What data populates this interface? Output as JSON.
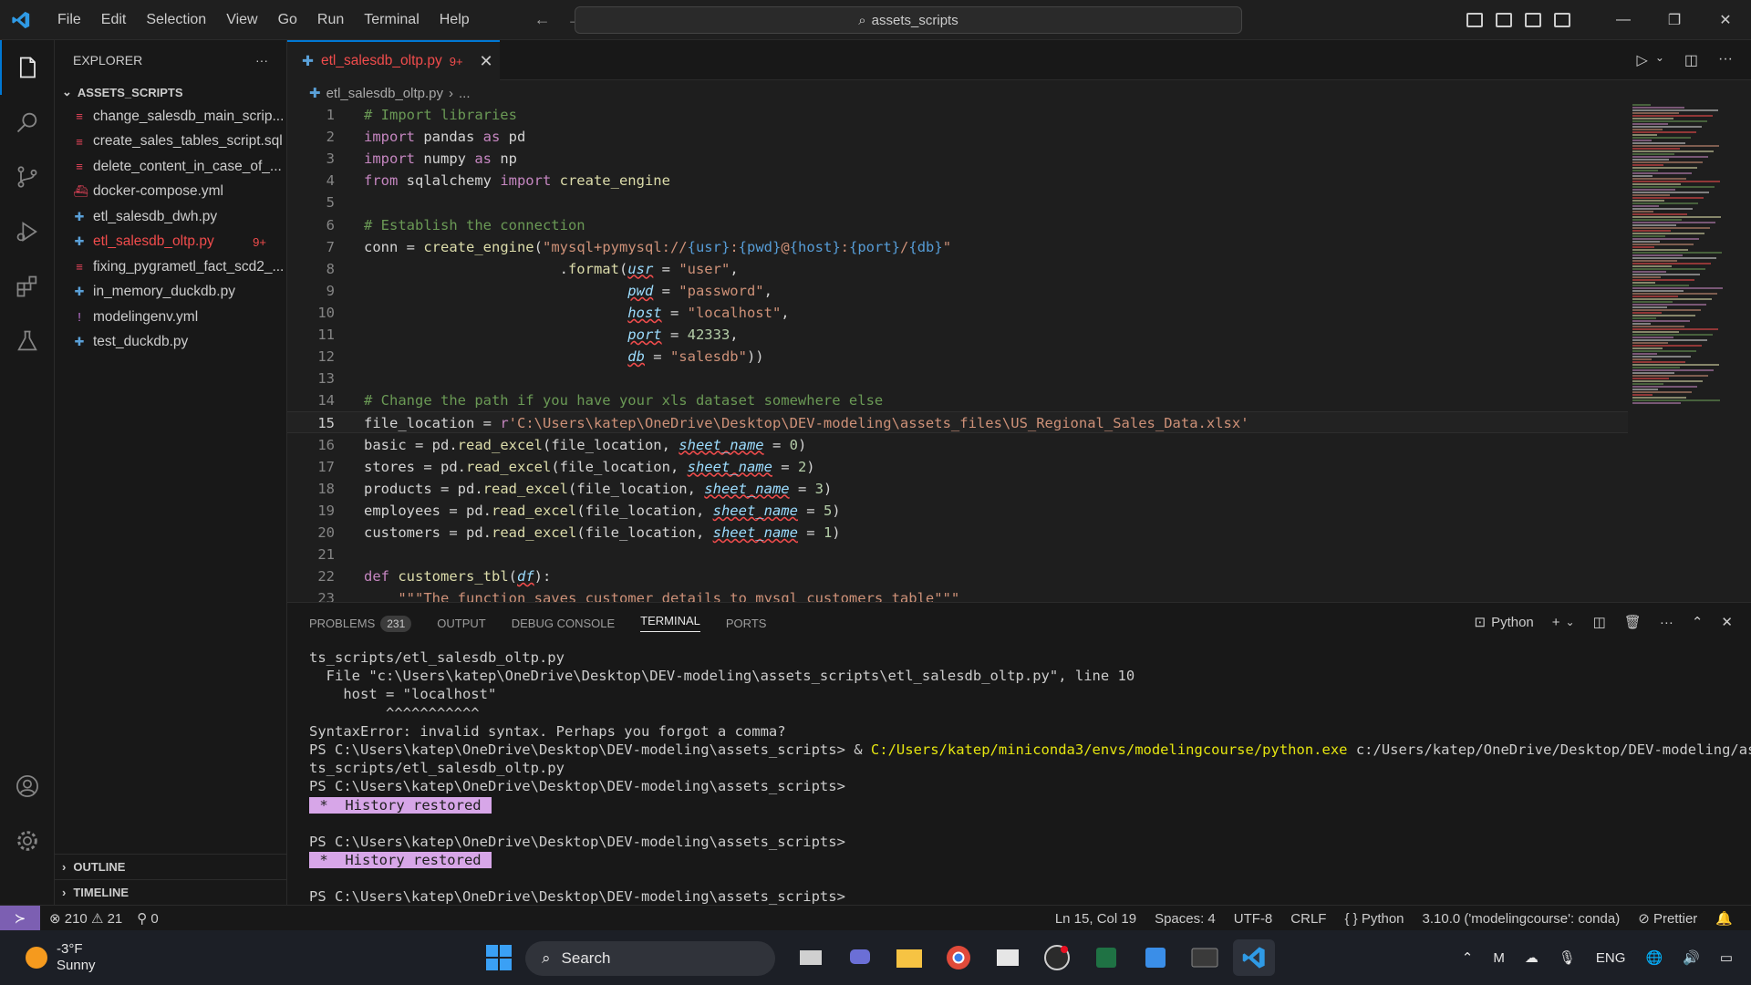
{
  "titlebar": {
    "menu": [
      "File",
      "Edit",
      "Selection",
      "View",
      "Go",
      "Run",
      "Terminal",
      "Help"
    ],
    "search_text": "assets_scripts"
  },
  "sidebar": {
    "title": "EXPLORER",
    "folder": "ASSETS_SCRIPTS",
    "files": [
      {
        "name": "change_salesdb_main_scrip...",
        "kind": "db",
        "error": false
      },
      {
        "name": "create_sales_tables_script.sql",
        "kind": "db",
        "error": false
      },
      {
        "name": "delete_content_in_case_of_...",
        "kind": "db",
        "error": false
      },
      {
        "name": "docker-compose.yml",
        "kind": "docker",
        "error": false
      },
      {
        "name": "etl_salesdb_dwh.py",
        "kind": "py",
        "error": false
      },
      {
        "name": "etl_salesdb_oltp.py",
        "kind": "py",
        "error": true,
        "badge": "9+"
      },
      {
        "name": "fixing_pygrametl_fact_scd2_...",
        "kind": "db",
        "error": false
      },
      {
        "name": "in_memory_duckdb.py",
        "kind": "py",
        "error": false
      },
      {
        "name": "modelingenv.yml",
        "kind": "yml",
        "error": false
      },
      {
        "name": "test_duckdb.py",
        "kind": "py",
        "error": false
      }
    ],
    "outline": "OUTLINE",
    "timeline": "TIMELINE"
  },
  "tab": {
    "name": "etl_salesdb_oltp.py",
    "count": "9+"
  },
  "breadcrumb": {
    "file": "etl_salesdb_oltp.py",
    "rest": "..."
  },
  "editor": {
    "current_line": 15,
    "lines": [
      {
        "n": "1",
        "t": [
          [
            "c",
            "# Import libraries"
          ]
        ]
      },
      {
        "n": "2",
        "t": [
          [
            "k",
            "import"
          ],
          [
            "p",
            " pandas "
          ],
          [
            "k",
            "as"
          ],
          [
            "p",
            " pd"
          ]
        ]
      },
      {
        "n": "3",
        "t": [
          [
            "k",
            "import"
          ],
          [
            "p",
            " numpy "
          ],
          [
            "k",
            "as"
          ],
          [
            "p",
            " np"
          ]
        ]
      },
      {
        "n": "4",
        "t": [
          [
            "k",
            "from"
          ],
          [
            "p",
            " sqlalchemy "
          ],
          [
            "k",
            "import"
          ],
          [
            "f",
            " create_engine"
          ]
        ]
      },
      {
        "n": "5",
        "t": []
      },
      {
        "n": "6",
        "t": [
          [
            "c",
            "# Establish the connection"
          ]
        ]
      },
      {
        "n": "7",
        "t": [
          [
            "p",
            "conn = "
          ],
          [
            "f",
            "create_engine"
          ],
          [
            "p",
            "("
          ],
          [
            "s",
            "\"mysql+pymysql://"
          ],
          [
            "v",
            "{usr}"
          ],
          [
            "s",
            ":"
          ],
          [
            "v",
            "{pwd}"
          ],
          [
            "s",
            "@"
          ],
          [
            "v",
            "{host}"
          ],
          [
            "s",
            ":"
          ],
          [
            "v",
            "{port}"
          ],
          [
            "s",
            "/"
          ],
          [
            "v",
            "{db}"
          ],
          [
            "s",
            "\""
          ]
        ]
      },
      {
        "n": "8",
        "t": [
          [
            "p",
            "                       ."
          ],
          [
            "f",
            "format"
          ],
          [
            "p",
            "("
          ],
          [
            "e",
            "usr"
          ],
          [
            "p",
            " = "
          ],
          [
            "s",
            "\"user\""
          ],
          [
            "p",
            ","
          ]
        ]
      },
      {
        "n": "9",
        "t": [
          [
            "p",
            "                               "
          ],
          [
            "e",
            "pwd"
          ],
          [
            "p",
            " = "
          ],
          [
            "s",
            "\"password\""
          ],
          [
            "p",
            ","
          ]
        ]
      },
      {
        "n": "10",
        "t": [
          [
            "p",
            "                               "
          ],
          [
            "e",
            "host"
          ],
          [
            "p",
            " = "
          ],
          [
            "s",
            "\"localhost\""
          ],
          [
            "p",
            ","
          ]
        ]
      },
      {
        "n": "11",
        "t": [
          [
            "p",
            "                               "
          ],
          [
            "e",
            "port"
          ],
          [
            "p",
            " = "
          ],
          [
            "n",
            "42333"
          ],
          [
            "p",
            ","
          ]
        ]
      },
      {
        "n": "12",
        "t": [
          [
            "p",
            "                               "
          ],
          [
            "e",
            "db"
          ],
          [
            "p",
            " = "
          ],
          [
            "s",
            "\"salesdb\""
          ],
          [
            "p",
            "))"
          ]
        ]
      },
      {
        "n": "13",
        "t": []
      },
      {
        "n": "14",
        "t": [
          [
            "c",
            "# Change the path if you have your xls dataset somewhere else"
          ]
        ]
      },
      {
        "n": "15",
        "t": [
          [
            "p",
            "file_location = "
          ],
          [
            "k",
            "r"
          ],
          [
            "s",
            "'C:\\Users\\katep\\OneDrive\\Desktop\\DEV-modeling\\assets_files\\US_Regional_Sales_Data.xlsx'"
          ]
        ]
      },
      {
        "n": "16",
        "t": [
          [
            "p",
            "basic = pd."
          ],
          [
            "f",
            "read_excel"
          ],
          [
            "p",
            "(file_location, "
          ],
          [
            "e",
            "sheet_name"
          ],
          [
            "p",
            " = "
          ],
          [
            "n",
            "0"
          ],
          [
            "p",
            ")"
          ]
        ]
      },
      {
        "n": "17",
        "t": [
          [
            "p",
            "stores = pd."
          ],
          [
            "f",
            "read_excel"
          ],
          [
            "p",
            "(file_location, "
          ],
          [
            "e",
            "sheet_name"
          ],
          [
            "p",
            " = "
          ],
          [
            "n",
            "2"
          ],
          [
            "p",
            ")"
          ]
        ]
      },
      {
        "n": "18",
        "t": [
          [
            "p",
            "products = pd."
          ],
          [
            "f",
            "read_excel"
          ],
          [
            "p",
            "(file_location, "
          ],
          [
            "e",
            "sheet_name"
          ],
          [
            "p",
            " = "
          ],
          [
            "n",
            "3"
          ],
          [
            "p",
            ")"
          ]
        ]
      },
      {
        "n": "19",
        "t": [
          [
            "p",
            "employees = pd."
          ],
          [
            "f",
            "read_excel"
          ],
          [
            "p",
            "(file_location, "
          ],
          [
            "e",
            "sheet_name"
          ],
          [
            "p",
            " = "
          ],
          [
            "n",
            "5"
          ],
          [
            "p",
            ")"
          ]
        ]
      },
      {
        "n": "20",
        "t": [
          [
            "p",
            "customers = pd."
          ],
          [
            "f",
            "read_excel"
          ],
          [
            "p",
            "(file_location, "
          ],
          [
            "e",
            "sheet_name"
          ],
          [
            "p",
            " = "
          ],
          [
            "n",
            "1"
          ],
          [
            "p",
            ")"
          ]
        ]
      },
      {
        "n": "21",
        "t": []
      },
      {
        "n": "22",
        "t": [
          [
            "k",
            "def"
          ],
          [
            "f",
            " customers_tbl"
          ],
          [
            "p",
            "("
          ],
          [
            "e2",
            "df"
          ],
          [
            "p",
            "):"
          ]
        ]
      },
      {
        "n": "23",
        "t": [
          [
            "s",
            "    \"\"\"The function saves customer details to mysql customers table\"\"\""
          ]
        ]
      }
    ]
  },
  "panel": {
    "tabs": [
      "PROBLEMS",
      "OUTPUT",
      "DEBUG CONSOLE",
      "TERMINAL",
      "PORTS"
    ],
    "problems_count": "231",
    "active_tab": "TERMINAL",
    "shell": "Python",
    "terminal_lines": [
      {
        "t": "ts_scripts/etl_salesdb_oltp.py"
      },
      {
        "t": "  File \"c:\\Users\\katep\\OneDrive\\Desktop\\DEV-modeling\\assets_scripts\\etl_salesdb_oltp.py\", line 10"
      },
      {
        "t": "    host = \"localhost\""
      },
      {
        "t": "         ^^^^^^^^^^^"
      },
      {
        "t": "SyntaxError: invalid syntax. Perhaps you forgot a comma?"
      },
      {
        "t": "PS C:\\Users\\katep\\OneDrive\\Desktop\\DEV-modeling\\assets_scripts> & ",
        "y": "C:/Users/katep/miniconda3/envs/modelingcourse/python.exe",
        "r": " c:/Users/katep/OneDrive/Desktop/DEV-modeling/asse"
      },
      {
        "t": "ts_scripts/etl_salesdb_oltp.py"
      },
      {
        "t": "PS C:\\Users\\katep\\OneDrive\\Desktop\\DEV-modeling\\assets_scripts>"
      },
      {
        "h": " *  History restored "
      },
      {
        "t": ""
      },
      {
        "t": "PS C:\\Users\\katep\\OneDrive\\Desktop\\DEV-modeling\\assets_scripts>"
      },
      {
        "h": " *  History restored "
      },
      {
        "t": ""
      },
      {
        "t": "PS C:\\Users\\katep\\OneDrive\\Desktop\\DEV-modeling\\assets_scripts>"
      }
    ]
  },
  "status": {
    "errors": "210",
    "warnings": "21",
    "ports": "0",
    "position": "Ln 15, Col 19",
    "spaces": "Spaces: 4",
    "encoding": "UTF-8",
    "eol": "CRLF",
    "language": "Python",
    "interpreter": "3.10.0 ('modelingcourse': conda)",
    "formatter": "Prettier"
  },
  "taskbar": {
    "temp": "-3°F",
    "weather": "Sunny",
    "search": "Search",
    "lang": "ENG"
  },
  "colors": {
    "accent": "#0078d4",
    "error": "#f14c4c",
    "remote": "#7c5fb2"
  }
}
